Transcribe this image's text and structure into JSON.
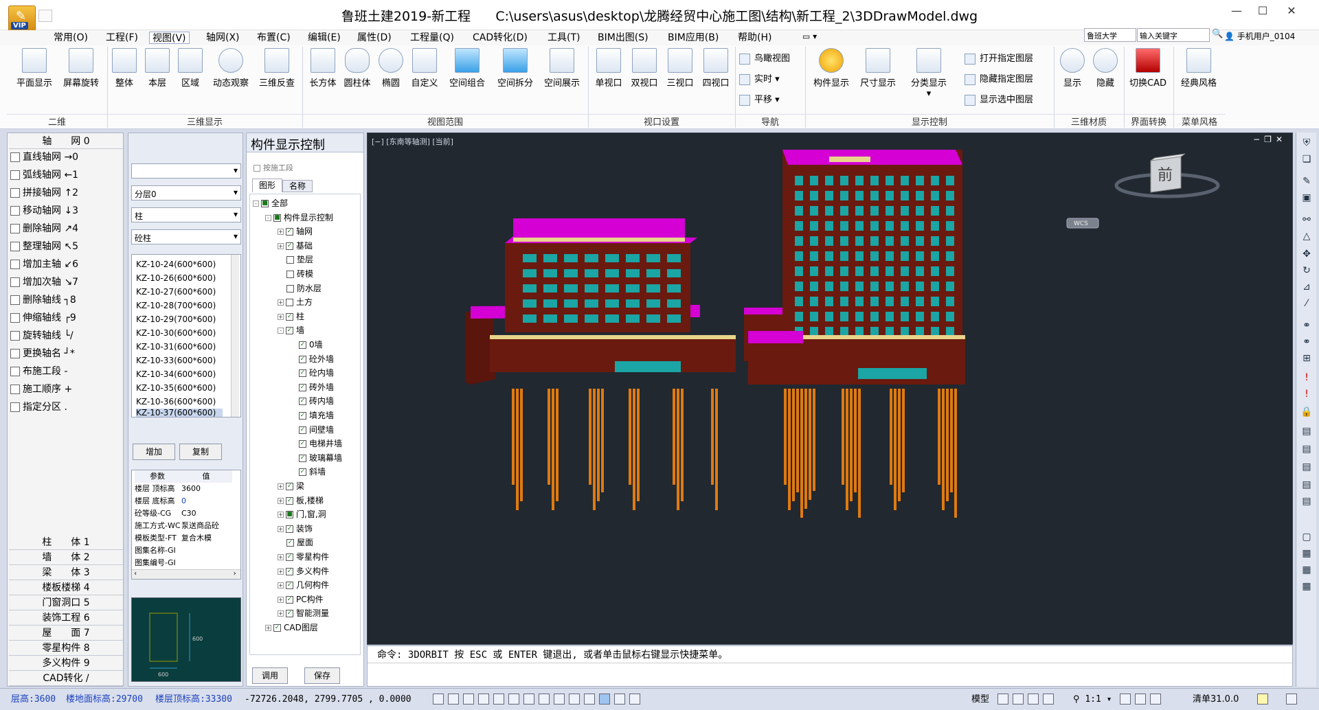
{
  "app": {
    "title": "鲁班土建2019-新工程",
    "path": "C:\\users\\asus\\desktop\\龙腾经贸中心施工图\\结构\\新工程_2\\3DDrawModel.dwg",
    "logo_badge": "VIP"
  },
  "menu": [
    "常用(O)",
    "工程(F)",
    "视图(V)",
    "轴网(X)",
    "布置(C)",
    "编辑(E)",
    "属性(D)",
    "工程量(Q)",
    "CAD转化(D)",
    "工具(T)",
    "BIM出图(S)",
    "BIM应用(B)",
    "帮助(H)"
  ],
  "menu_selected": "视图(V)",
  "search": {
    "scope": "鲁班大学",
    "placeholder": "输入关键字",
    "user": "手机用户_0104"
  },
  "ribbon": {
    "buttons": [
      "平面显示",
      "屏幕旋转",
      "整体",
      "本层",
      "区域",
      "动态观察",
      "三维反查",
      "长方体",
      "圆柱体",
      "椭圆",
      "自定义",
      "空间组合",
      "空间拆分",
      "空间展示",
      "单视口",
      "双视口",
      "三视口",
      "四视口"
    ],
    "nav": [
      "鸟瞰视图",
      "实时",
      "平移"
    ],
    "display": [
      "构件显示",
      "尺寸显示",
      "分类显示"
    ],
    "layers": [
      "打开指定图层",
      "隐藏指定图层",
      "显示选中图层"
    ],
    "material": [
      "显示",
      "隐藏"
    ],
    "ui": [
      "切换CAD"
    ],
    "style": [
      "经典风格"
    ],
    "groups": [
      "二维",
      "三维显示",
      "视图范围",
      "视口设置",
      "导航",
      "显示控制",
      "三维材质",
      "界面转换",
      "菜单风格"
    ]
  },
  "left_panel": {
    "header": "轴　　网 0",
    "items": [
      "直线轴网 →0",
      "弧线轴网 ←1",
      "拼接轴网 ↑2",
      "移动轴网 ↓3",
      "删除轴网 ↗4",
      "整理轴网 ↖5",
      "增加主轴 ↙6",
      "增加次轴 ↘7",
      "删除轴线 ┐8",
      "伸缩轴线 ┌9",
      "旋转轴线 └/",
      "更换轴名 ┘*",
      "布施工段 -",
      "施工顺序 +",
      "指定分区 ."
    ],
    "categories": [
      "柱　　体 1",
      "墙　　体 2",
      "梁　　体 3",
      "楼板楼梯 4",
      "门窗洞口 5",
      "装饰工程 6",
      "屋　　面 7",
      "零星构件 8",
      "多义构件 9",
      "CAD转化 /"
    ]
  },
  "prop_panel": {
    "dropdowns": [
      "",
      "分层0",
      "柱",
      "砼柱"
    ],
    "list": [
      "KZ-10-24(600*600)",
      "KZ-10-26(600*600)",
      "KZ-10-27(600*600)",
      "KZ-10-28(700*600)",
      "KZ-10-29(700*600)",
      "KZ-10-30(600*600)",
      "KZ-10-31(600*600)",
      "KZ-10-33(600*600)",
      "KZ-10-34(600*600)",
      "KZ-10-35(600*600)",
      "KZ-10-36(600*600)",
      "KZ-10-37(600*600)"
    ],
    "selected": "KZ-10-37(600*600)",
    "add_btn": "增加",
    "copy_btn": "复制",
    "table_head": [
      "参数",
      "值"
    ],
    "table": [
      [
        "楼层 顶标高",
        "3600"
      ],
      [
        "楼层 底标高",
        "0"
      ],
      [
        "砼等级-CG",
        "C30"
      ],
      [
        "施工方式-WC",
        "泵送商品砼"
      ],
      [
        "模板类型-FT",
        "复合木模"
      ],
      [
        "图集名称-GI",
        ""
      ],
      [
        "图集编号-GI",
        ""
      ]
    ],
    "preview_dims": [
      "600",
      "600"
    ]
  },
  "tree_panel": {
    "title": "构件显示控制",
    "check_label": "按施工段",
    "tabs": [
      "图形",
      "名称"
    ],
    "nodes": [
      {
        "t": "全部",
        "lvl": 0,
        "ex": "-",
        "cb": "■"
      },
      {
        "t": "构件显示控制",
        "lvl": 1,
        "ex": "-",
        "cb": "■"
      },
      {
        "t": "轴网",
        "lvl": 2,
        "ex": "+",
        "cb": "✓"
      },
      {
        "t": "基础",
        "lvl": 2,
        "ex": "+",
        "cb": "✓"
      },
      {
        "t": "垫层",
        "lvl": 2,
        "ex": "",
        "cb": ""
      },
      {
        "t": "砖模",
        "lvl": 2,
        "ex": "",
        "cb": ""
      },
      {
        "t": "防水层",
        "lvl": 2,
        "ex": "",
        "cb": ""
      },
      {
        "t": "土方",
        "lvl": 2,
        "ex": "+",
        "cb": ""
      },
      {
        "t": "柱",
        "lvl": 2,
        "ex": "+",
        "cb": "✓"
      },
      {
        "t": "墙",
        "lvl": 2,
        "ex": "-",
        "cb": "✓"
      },
      {
        "t": "0墙",
        "lvl": 3,
        "ex": "",
        "cb": "✓"
      },
      {
        "t": "砼外墙",
        "lvl": 3,
        "ex": "",
        "cb": "✓"
      },
      {
        "t": "砼内墙",
        "lvl": 3,
        "ex": "",
        "cb": "✓"
      },
      {
        "t": "砖外墙",
        "lvl": 3,
        "ex": "",
        "cb": "✓"
      },
      {
        "t": "砖内墙",
        "lvl": 3,
        "ex": "",
        "cb": "✓"
      },
      {
        "t": "填充墙",
        "lvl": 3,
        "ex": "",
        "cb": "✓"
      },
      {
        "t": "间壁墙",
        "lvl": 3,
        "ex": "",
        "cb": "✓"
      },
      {
        "t": "电梯井墙",
        "lvl": 3,
        "ex": "",
        "cb": "✓"
      },
      {
        "t": "玻璃幕墙",
        "lvl": 3,
        "ex": "",
        "cb": "✓"
      },
      {
        "t": "斜墙",
        "lvl": 3,
        "ex": "",
        "cb": "✓"
      },
      {
        "t": "梁",
        "lvl": 2,
        "ex": "+",
        "cb": "✓"
      },
      {
        "t": "板,楼梯",
        "lvl": 2,
        "ex": "+",
        "cb": "✓"
      },
      {
        "t": "门,窗,洞",
        "lvl": 2,
        "ex": "+",
        "cb": "■"
      },
      {
        "t": "装饰",
        "lvl": 2,
        "ex": "+",
        "cb": "✓"
      },
      {
        "t": "屋面",
        "lvl": 2,
        "ex": "",
        "cb": "✓"
      },
      {
        "t": "零星构件",
        "lvl": 2,
        "ex": "+",
        "cb": "✓"
      },
      {
        "t": "多义构件",
        "lvl": 2,
        "ex": "+",
        "cb": "✓"
      },
      {
        "t": "几何构件",
        "lvl": 2,
        "ex": "+",
        "cb": "✓"
      },
      {
        "t": "PC构件",
        "lvl": 2,
        "ex": "+",
        "cb": "✓"
      },
      {
        "t": "智能测量",
        "lvl": 2,
        "ex": "+",
        "cb": "✓"
      },
      {
        "t": "CAD图层",
        "lvl": 1,
        "ex": "+",
        "cb": "✓"
      }
    ],
    "apply_btn": "调用",
    "save_btn": "保存"
  },
  "viewport": {
    "label": "[−] [东南等轴测] [当前]",
    "viewcube_face": "前",
    "wcs": "WCS",
    "controls": [
      "−",
      "❐",
      "✕"
    ]
  },
  "command": "命令: 3DORBIT 按 ESC 或 ENTER 键退出, 或者单击鼠标右键显示快捷菜单。",
  "status": {
    "floor_height": "层高:3600",
    "floor_base": "楼地面标高:29700",
    "floor_top": "楼层顶标高:33300",
    "coords": "-72726.2048, 2799.7705 , 0.0000",
    "model": "模型",
    "scale": "1:1",
    "list": "清单31.0.0"
  },
  "colors": {
    "facade": "#6b1a0f",
    "roof": "#d400d4",
    "window": "#1ba5a5",
    "slab": "#e8d48a",
    "pile": "#e07a10",
    "viewport_bg": "#212830"
  }
}
